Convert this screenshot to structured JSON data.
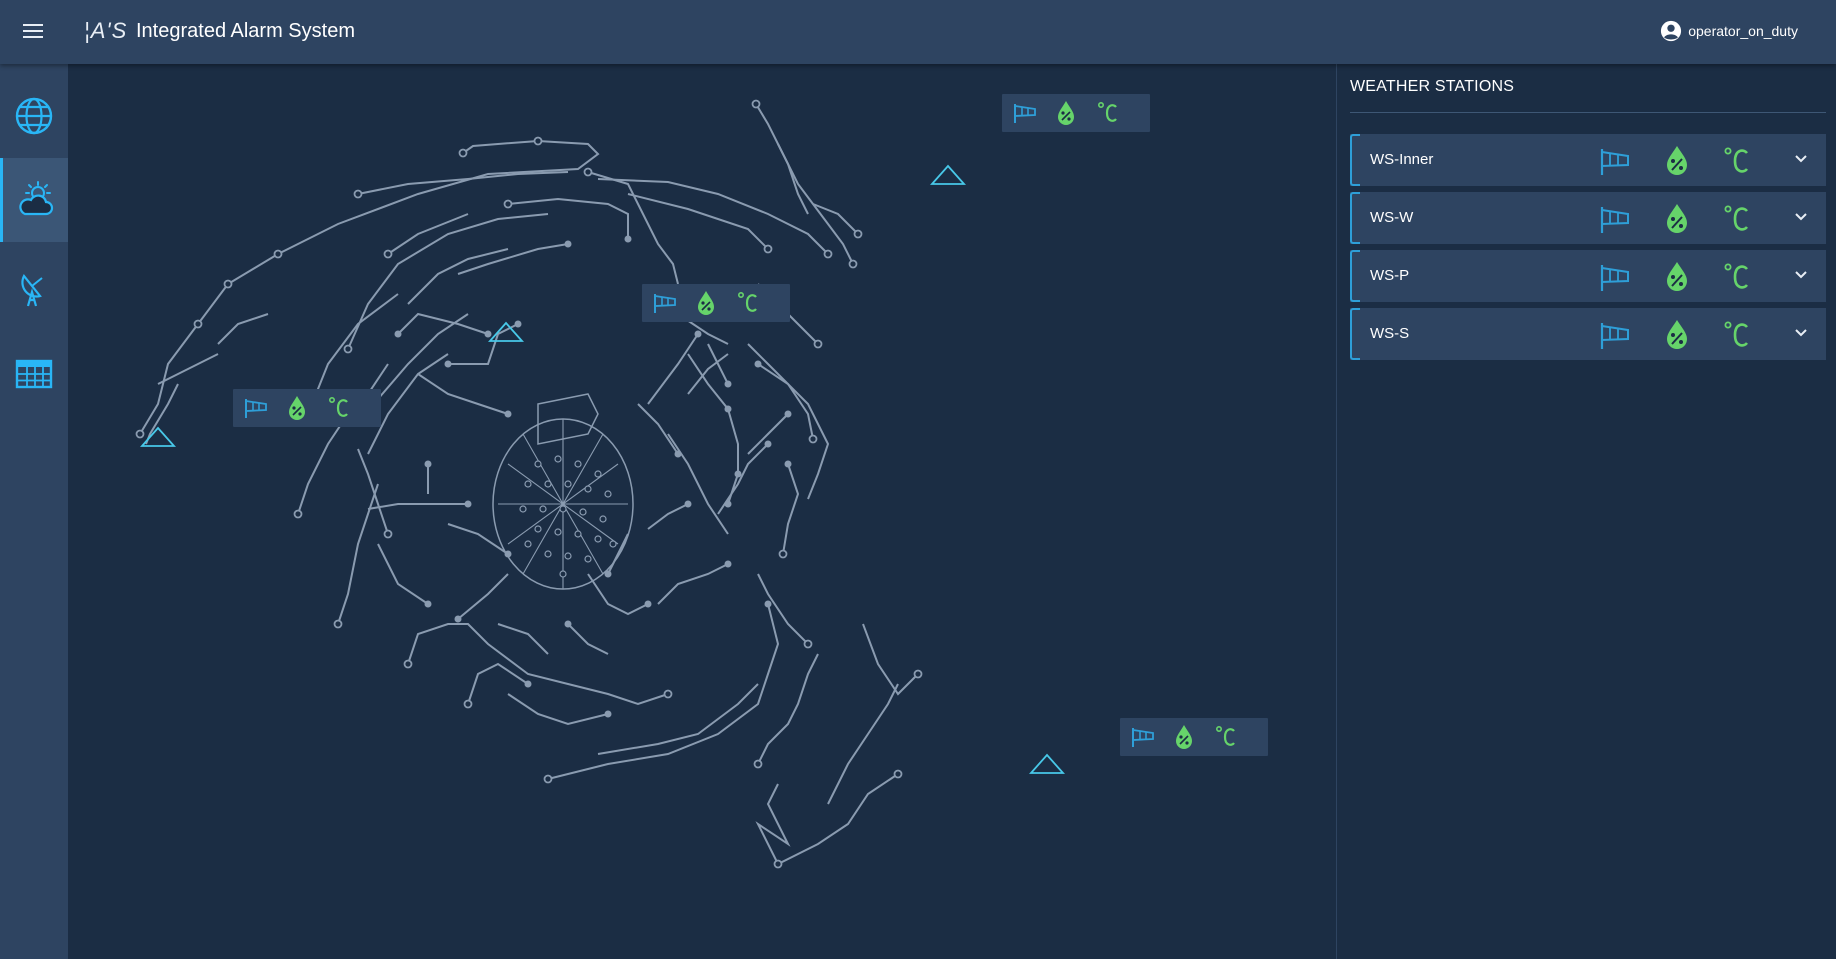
{
  "header": {
    "logo": "¦A'S",
    "title": "Integrated Alarm System",
    "user": "operator_on_duty"
  },
  "sidebar": {
    "items": [
      {
        "name": "globe-icon",
        "active": false
      },
      {
        "name": "weather-icon",
        "active": true
      },
      {
        "name": "antenna-icon",
        "active": false
      },
      {
        "name": "table-icon",
        "active": false
      }
    ]
  },
  "panel": {
    "title": "WEATHER STATIONS",
    "stations": [
      {
        "name": "WS-Inner"
      },
      {
        "name": "WS-W"
      },
      {
        "name": "WS-P"
      },
      {
        "name": "WS-S"
      }
    ]
  },
  "colors": {
    "background": "#1b2d44",
    "bar": "#2e4461",
    "wind": "#2e9fd8",
    "humidity": "#66d46a",
    "temperature": "#66d46a",
    "map_lines": "#8a9bb0",
    "station_marker": "#48c8e8"
  }
}
